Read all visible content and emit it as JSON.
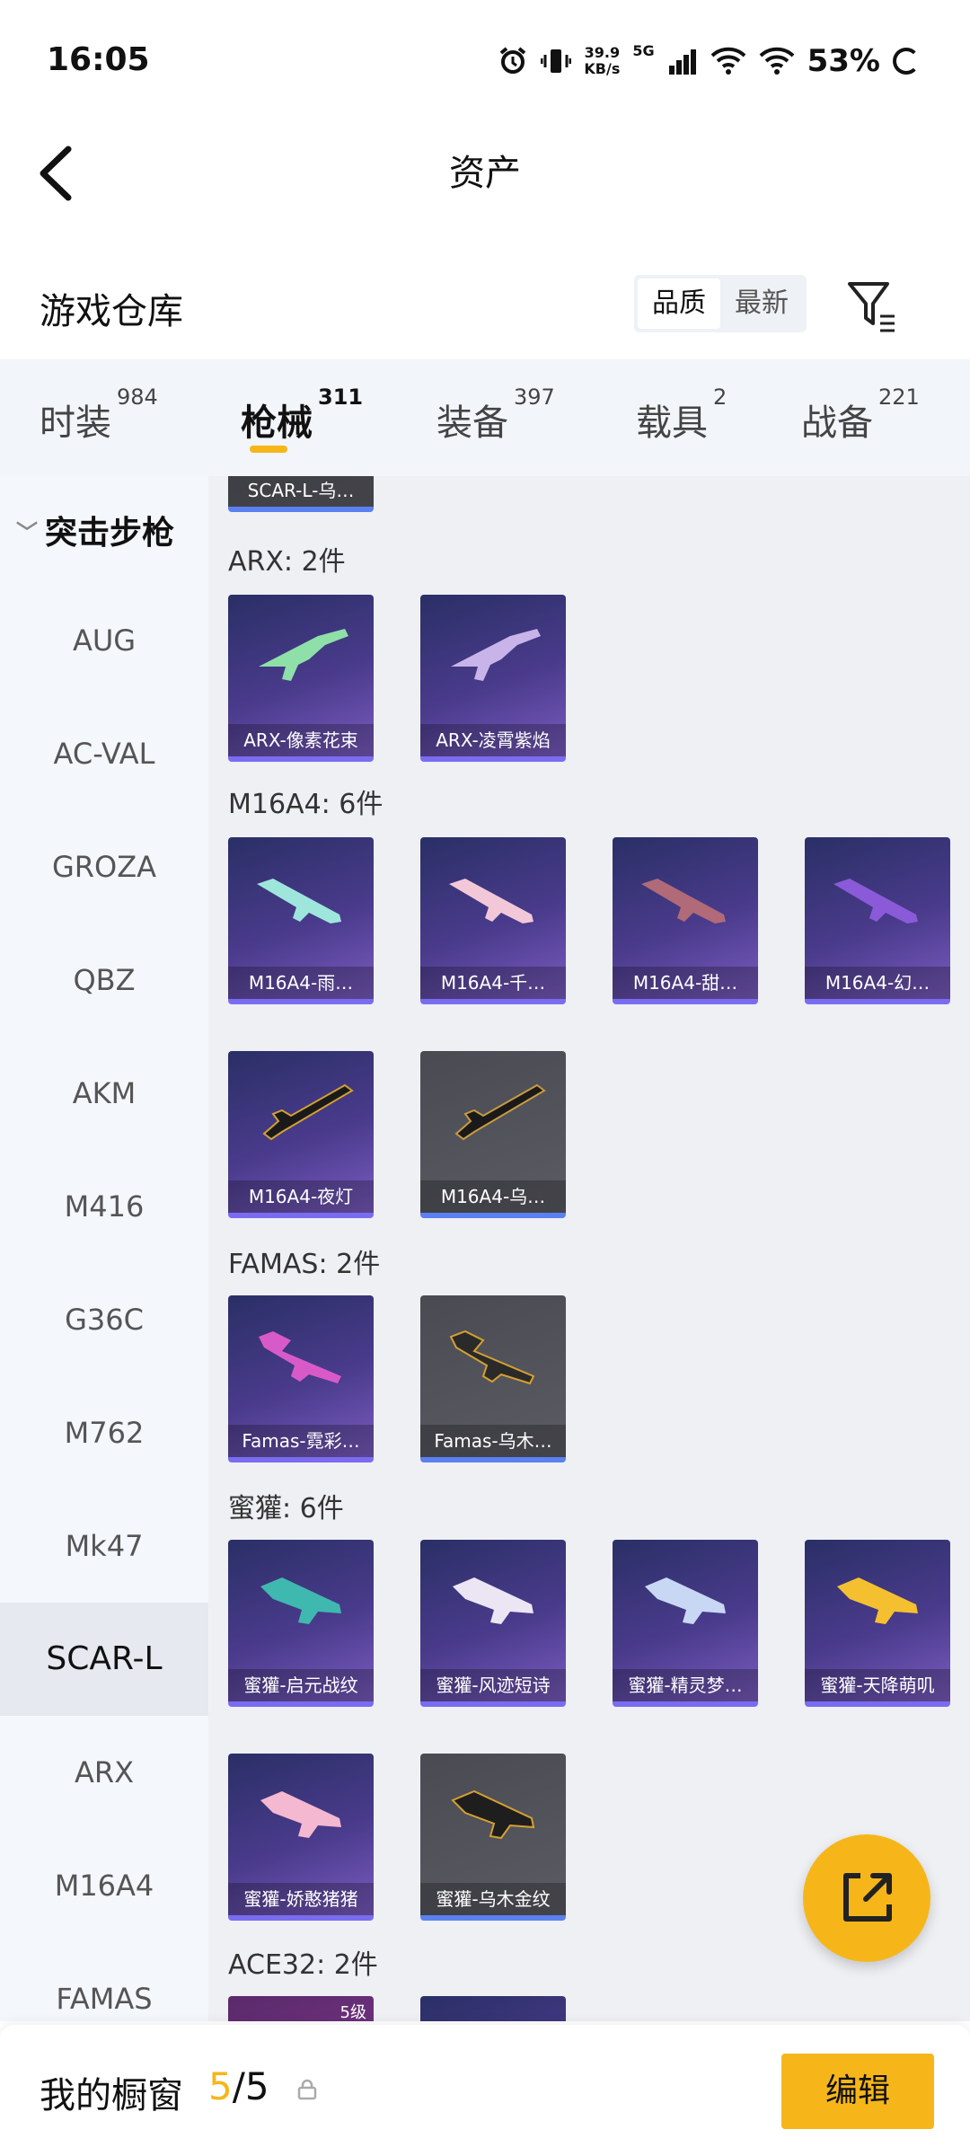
{
  "status": {
    "time": "16:05",
    "speed_value": "39.9",
    "speed_unit": "KB/s",
    "net": "5G",
    "battery": "53%"
  },
  "nav": {
    "title": "资产"
  },
  "section": {
    "title": "游戏仓库",
    "sort_options": [
      "品质",
      "最新"
    ]
  },
  "tabs": [
    {
      "label": "时装",
      "count": "984"
    },
    {
      "label": "枪械",
      "count": "311"
    },
    {
      "label": "装备",
      "count": "397"
    },
    {
      "label": "载具",
      "count": "2"
    },
    {
      "label": "战备",
      "count": "221"
    }
  ],
  "side": {
    "group": "突击步枪",
    "items": [
      "AUG",
      "AC-VAL",
      "GROZA",
      "QBZ",
      "AKM",
      "M416",
      "G36C",
      "M762",
      "Mk47",
      "SCAR-L",
      "ARX",
      "M16A4",
      "FAMAS"
    ]
  },
  "main": {
    "top_partial_card": "SCAR-L-乌…",
    "groups": [
      {
        "label": "ARX: 2件",
        "items": [
          "ARX-像素花束",
          "ARX-凌霄紫焰"
        ]
      },
      {
        "label": "M16A4: 6件",
        "items": [
          "M16A4-雨…",
          "M16A4-千…",
          "M16A4-甜…",
          "M16A4-幻…",
          "M16A4-夜灯",
          "M16A4-乌…"
        ]
      },
      {
        "label": "FAMAS: 2件",
        "items": [
          "Famas-霓彩…",
          "Famas-乌木…"
        ]
      },
      {
        "label": "蜜獾: 6件",
        "items": [
          "蜜獾-启元战纹",
          "蜜獾-风迹短诗",
          "蜜獾-精灵梦…",
          "蜜獾-天降萌叽",
          "蜜獾-娇憨猪猪",
          "蜜獾-乌木金纹"
        ]
      },
      {
        "label": "ACE32: 2件",
        "items": [
          "5级"
        ]
      }
    ]
  },
  "bottom": {
    "title": "我的橱窗",
    "count_current": "5",
    "count_total": "/5",
    "edit_label": "编辑"
  }
}
